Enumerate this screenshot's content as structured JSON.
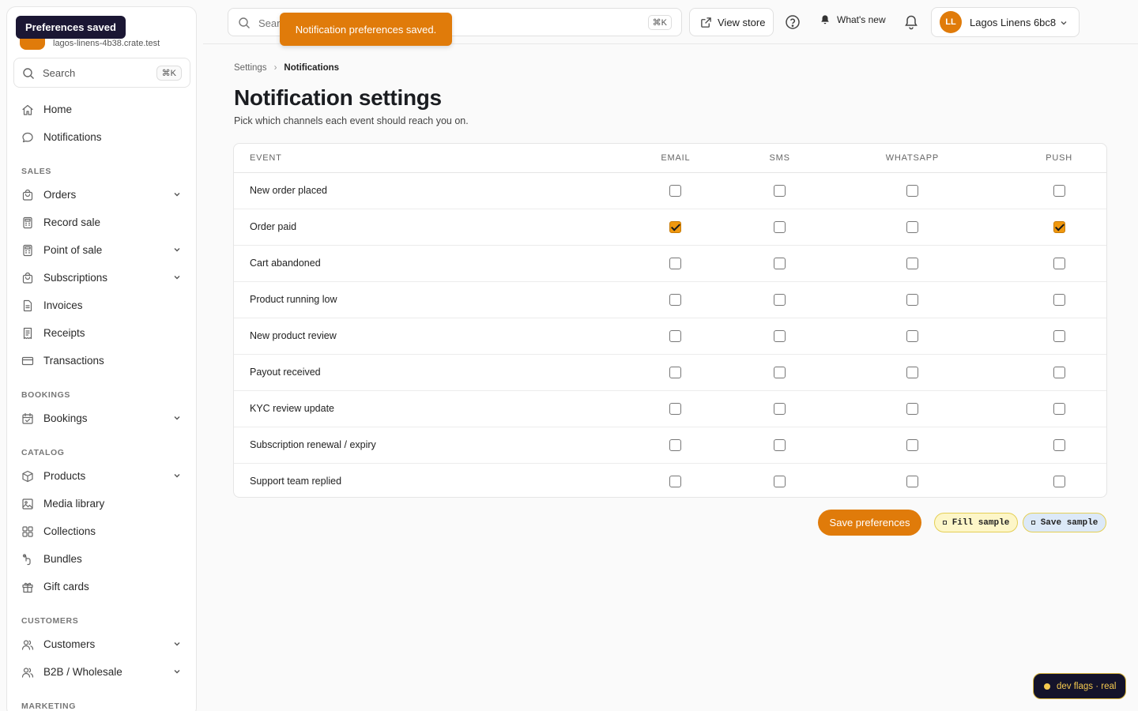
{
  "tooltip": "Preferences saved",
  "store": {
    "url": "lagos-linens-4b38.crate.test"
  },
  "sidebar": {
    "search_label": "Search",
    "search_kbd": "⌘K",
    "top_items": [
      {
        "label": "Home",
        "icon": "home-icon"
      },
      {
        "label": "Notifications",
        "icon": "chat-bubble-icon"
      }
    ],
    "sections": [
      {
        "title": "SALES",
        "items": [
          {
            "label": "Orders",
            "icon": "shopping-bag-icon",
            "expandable": true
          },
          {
            "label": "Record sale",
            "icon": "calculator-icon",
            "expandable": false
          },
          {
            "label": "Point of sale",
            "icon": "calculator-icon",
            "expandable": true
          },
          {
            "label": "Subscriptions",
            "icon": "shopping-bag-icon",
            "expandable": true
          },
          {
            "label": "Invoices",
            "icon": "document-icon",
            "expandable": false
          },
          {
            "label": "Receipts",
            "icon": "receipt-icon",
            "expandable": false
          },
          {
            "label": "Transactions",
            "icon": "credit-card-icon",
            "expandable": false
          }
        ]
      },
      {
        "title": "BOOKINGS",
        "items": [
          {
            "label": "Bookings",
            "icon": "calendar-check-icon",
            "expandable": true
          }
        ]
      },
      {
        "title": "CATALOG",
        "items": [
          {
            "label": "Products",
            "icon": "box-icon",
            "expandable": true
          },
          {
            "label": "Media library",
            "icon": "image-icon",
            "expandable": false
          },
          {
            "label": "Collections",
            "icon": "grid-icon",
            "expandable": false
          },
          {
            "label": "Bundles",
            "icon": "bundle-icon",
            "expandable": false
          },
          {
            "label": "Gift cards",
            "icon": "gift-icon",
            "expandable": false
          }
        ]
      },
      {
        "title": "CUSTOMERS",
        "items": [
          {
            "label": "Customers",
            "icon": "users-icon",
            "expandable": true
          },
          {
            "label": "B2B / Wholesale",
            "icon": "users-icon",
            "expandable": true
          }
        ]
      },
      {
        "title": "MARKETING",
        "items": []
      }
    ]
  },
  "topbar": {
    "search_placeholder": "Search orders, products, customers...",
    "search_kbd": "⌘K",
    "view_store": "View store",
    "whats_new": "What's new",
    "account_initials": "LL",
    "account_name": "Lagos Linens 6bc8"
  },
  "toast": "Notification preferences saved.",
  "breadcrumb": {
    "parent": "Settings",
    "current": "Notifications"
  },
  "page": {
    "title": "Notification settings",
    "subtitle": "Pick which channels each event should reach you on."
  },
  "table": {
    "columns": [
      "EVENT",
      "EMAIL",
      "SMS",
      "WHATSAPP",
      "PUSH"
    ],
    "rows": [
      {
        "event": "New order placed",
        "channels": [
          false,
          false,
          false,
          false
        ]
      },
      {
        "event": "Order paid",
        "channels": [
          true,
          false,
          false,
          true
        ]
      },
      {
        "event": "Cart abandoned",
        "channels": [
          false,
          false,
          false,
          false
        ]
      },
      {
        "event": "Product running low",
        "channels": [
          false,
          false,
          false,
          false
        ]
      },
      {
        "event": "New product review",
        "channels": [
          false,
          false,
          false,
          false
        ]
      },
      {
        "event": "Payout received",
        "channels": [
          false,
          false,
          false,
          false
        ]
      },
      {
        "event": "KYC review update",
        "channels": [
          false,
          false,
          false,
          false
        ]
      },
      {
        "event": "Subscription renewal / expiry",
        "channels": [
          false,
          false,
          false,
          false
        ]
      },
      {
        "event": "Support team replied",
        "channels": [
          false,
          false,
          false,
          false
        ]
      }
    ]
  },
  "actions": {
    "save": "Save preferences",
    "fill_sample": "Fill sample",
    "save_sample": "Save sample"
  },
  "dev_flags": "dev flags · real",
  "colors": {
    "accent": "#e07b0a",
    "checkbox_on": "#f0980f",
    "dark": "#1b1734"
  }
}
